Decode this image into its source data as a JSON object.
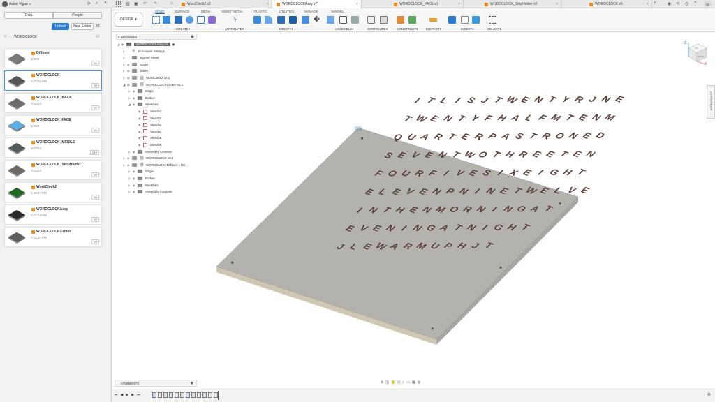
{
  "top_bar": {
    "user": "Aiden Vigue",
    "tabs": [
      "WordClock2 v2",
      "WORDCLOCKAssy v7*",
      "WORDCLOCK_FACE v1",
      "WORDCLOCK_StripHolder v2",
      "WORDCLOCK v5"
    ],
    "active_tab": 1,
    "avatar_initials": "AV"
  },
  "left_panel": {
    "segments": [
      "Data",
      "People"
    ],
    "upload_label": "Upload",
    "new_folder_label": "New Folder",
    "folder_name": "WORDCLOCK",
    "files": [
      {
        "name": "Diffuser",
        "date": "8/8/23",
        "version": "V1",
        "thumb": "#7a7a7a"
      },
      {
        "name": "WORDCLOCK",
        "date": "7:10:46 PM",
        "version": "V5",
        "thumb": "#555"
      },
      {
        "name": "WORDCLOCK_BACK",
        "date": "7/30/23",
        "version": "V1",
        "thumb": "#6d6d6d"
      },
      {
        "name": "WORDCLOCK_FACE",
        "date": "8/9/23",
        "version": "V1",
        "thumb": "#5ab0e8"
      },
      {
        "name": "WORDCLOCK_MIDDLE",
        "date": "3/28/24",
        "version": "V10",
        "thumb": "#4f5a5a"
      },
      {
        "name": "WORDCLOCK_StripHolder",
        "date": "7/30/23",
        "version": "V2",
        "thumb": "#6d6a66"
      },
      {
        "name": "WordClock2",
        "date": "6:40:27 PM",
        "version": "V2",
        "thumb": "#1f6b1f"
      },
      {
        "name": "WORDCLOCKAssy",
        "date": "7:14:23 PM",
        "version": "V7",
        "thumb": "#2a2a2a"
      },
      {
        "name": "WORDCLOCKCenter",
        "date": "7:14:21 PM",
        "version": "V3",
        "thumb": "#5d5d5d"
      }
    ]
  },
  "toolbar": {
    "design_label": "DESIGN",
    "tabs": [
      "SOLID",
      "SURFACE",
      "MESH",
      "SHEET METAL",
      "PLASTIC",
      "UTILITIES",
      "MANAGE",
      "SHMVEL"
    ],
    "active_tab": 0,
    "groups": [
      "CREATE",
      "AUTOMATE",
      "MODIFY",
      "ASSEMBLE",
      "CONFIGURE",
      "CONSTRUCT",
      "INSPECT",
      "INSERT",
      "SELECT"
    ]
  },
  "browser": {
    "title": "BROWSER",
    "tree": [
      {
        "label": "WORDCLOCKAssy v7",
        "level": 0,
        "type": "root"
      },
      {
        "label": "Document Settings",
        "level": 1,
        "type": "settings"
      },
      {
        "label": "Named Views",
        "level": 1,
        "type": "folder"
      },
      {
        "label": "Origin",
        "level": 1,
        "type": "folder"
      },
      {
        "label": "Joints",
        "level": 1,
        "type": "folder"
      },
      {
        "label": "WordClock2 v2:1",
        "level": 1,
        "type": "link"
      },
      {
        "label": "WORDCLOCKCenter v3:2",
        "level": 1,
        "type": "link"
      },
      {
        "label": "Origin",
        "level": 2,
        "type": "folder"
      },
      {
        "label": "Bodies",
        "level": 2,
        "type": "folder"
      },
      {
        "label": "Sketches",
        "level": 2,
        "type": "folder"
      },
      {
        "label": "Sketch1",
        "level": 3,
        "type": "sketch"
      },
      {
        "label": "Sketch2",
        "level": 3,
        "type": "sketch"
      },
      {
        "label": "Sketch3",
        "level": 3,
        "type": "sketch"
      },
      {
        "label": "Sketch4",
        "level": 3,
        "type": "sketch"
      },
      {
        "label": "Sketch5",
        "level": 3,
        "type": "sketch"
      },
      {
        "label": "Sketch6",
        "level": 3,
        "type": "sketch"
      },
      {
        "label": "Assembly Contexts",
        "level": 2,
        "type": "folder"
      },
      {
        "label": "WORDCLOCK v5:1",
        "level": 1,
        "type": "link"
      },
      {
        "label": "WORDCLOCKDiffuser 1 (Gr...",
        "level": 1,
        "type": "link"
      },
      {
        "label": "Origin",
        "level": 2,
        "type": "folder"
      },
      {
        "label": "Bodies",
        "level": 2,
        "type": "folder"
      },
      {
        "label": "Sketches",
        "level": 2,
        "type": "folder"
      },
      {
        "label": "Assembly Contexts",
        "level": 2,
        "type": "folder"
      }
    ]
  },
  "viewcube": {
    "labels": [
      "Z",
      "X",
      "TOP",
      "FRONT"
    ]
  },
  "appearance_label": "APPEARANCE",
  "comments_label": "COMMENTS",
  "clock_letters": [
    "ITLISJTWENTYRJNE",
    "TWENTYFHALFMTENM",
    "QUARTERPASTRONED",
    "SEVENTWOTHREETEN",
    "FOURFIVESIXEIGHT",
    "ELEVENPNINETWELVE",
    "INTHENMORNINGAT",
    "EVENINGATNIGHT",
    "JLEWARMUPHJT"
  ],
  "colors": {
    "plate": "#b4b2ac",
    "plate_dark": "#a9a7a1",
    "accent": "#1565c0",
    "orange": "#f28a1a"
  }
}
